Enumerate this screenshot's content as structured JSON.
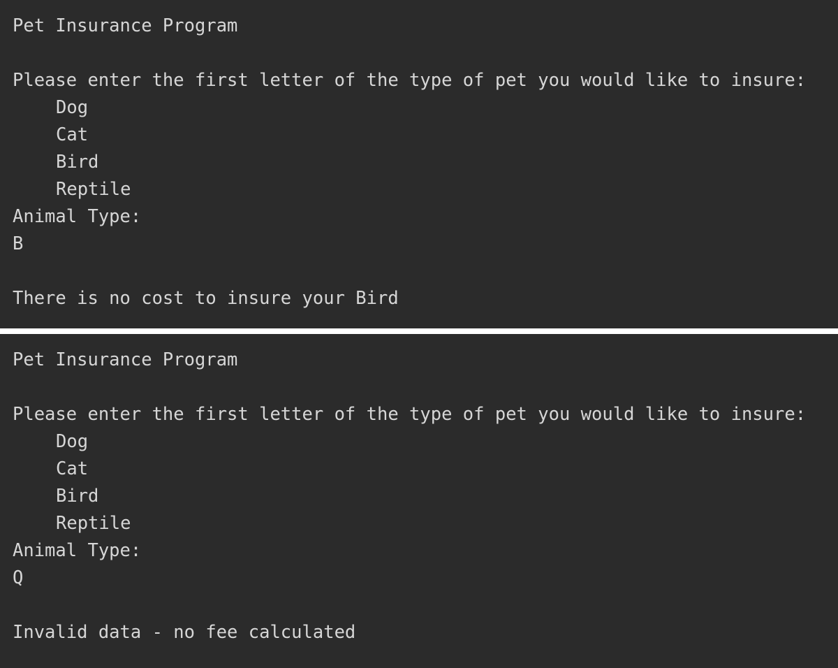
{
  "theme": {
    "background_color": "#2b2b2b",
    "text_color": "#d6d6d6",
    "gap_color": "#ffffff"
  },
  "runs": [
    {
      "title": "Pet Insurance Program",
      "blank_1": " ",
      "prompt": "Please enter the first letter of the type of pet you would like to insure:",
      "options": [
        "Dog",
        "Cat",
        "Bird",
        "Reptile"
      ],
      "input_label": "Animal Type:",
      "input_value": "B",
      "blank_2": " ",
      "result": "There is no cost to insure your Bird"
    },
    {
      "title": "Pet Insurance Program",
      "blank_1": " ",
      "prompt": "Please enter the first letter of the type of pet you would like to insure:",
      "options": [
        "Dog",
        "Cat",
        "Bird",
        "Reptile"
      ],
      "input_label": "Animal Type:",
      "input_value": "Q",
      "blank_2": " ",
      "result": "Invalid data - no fee calculated"
    }
  ]
}
